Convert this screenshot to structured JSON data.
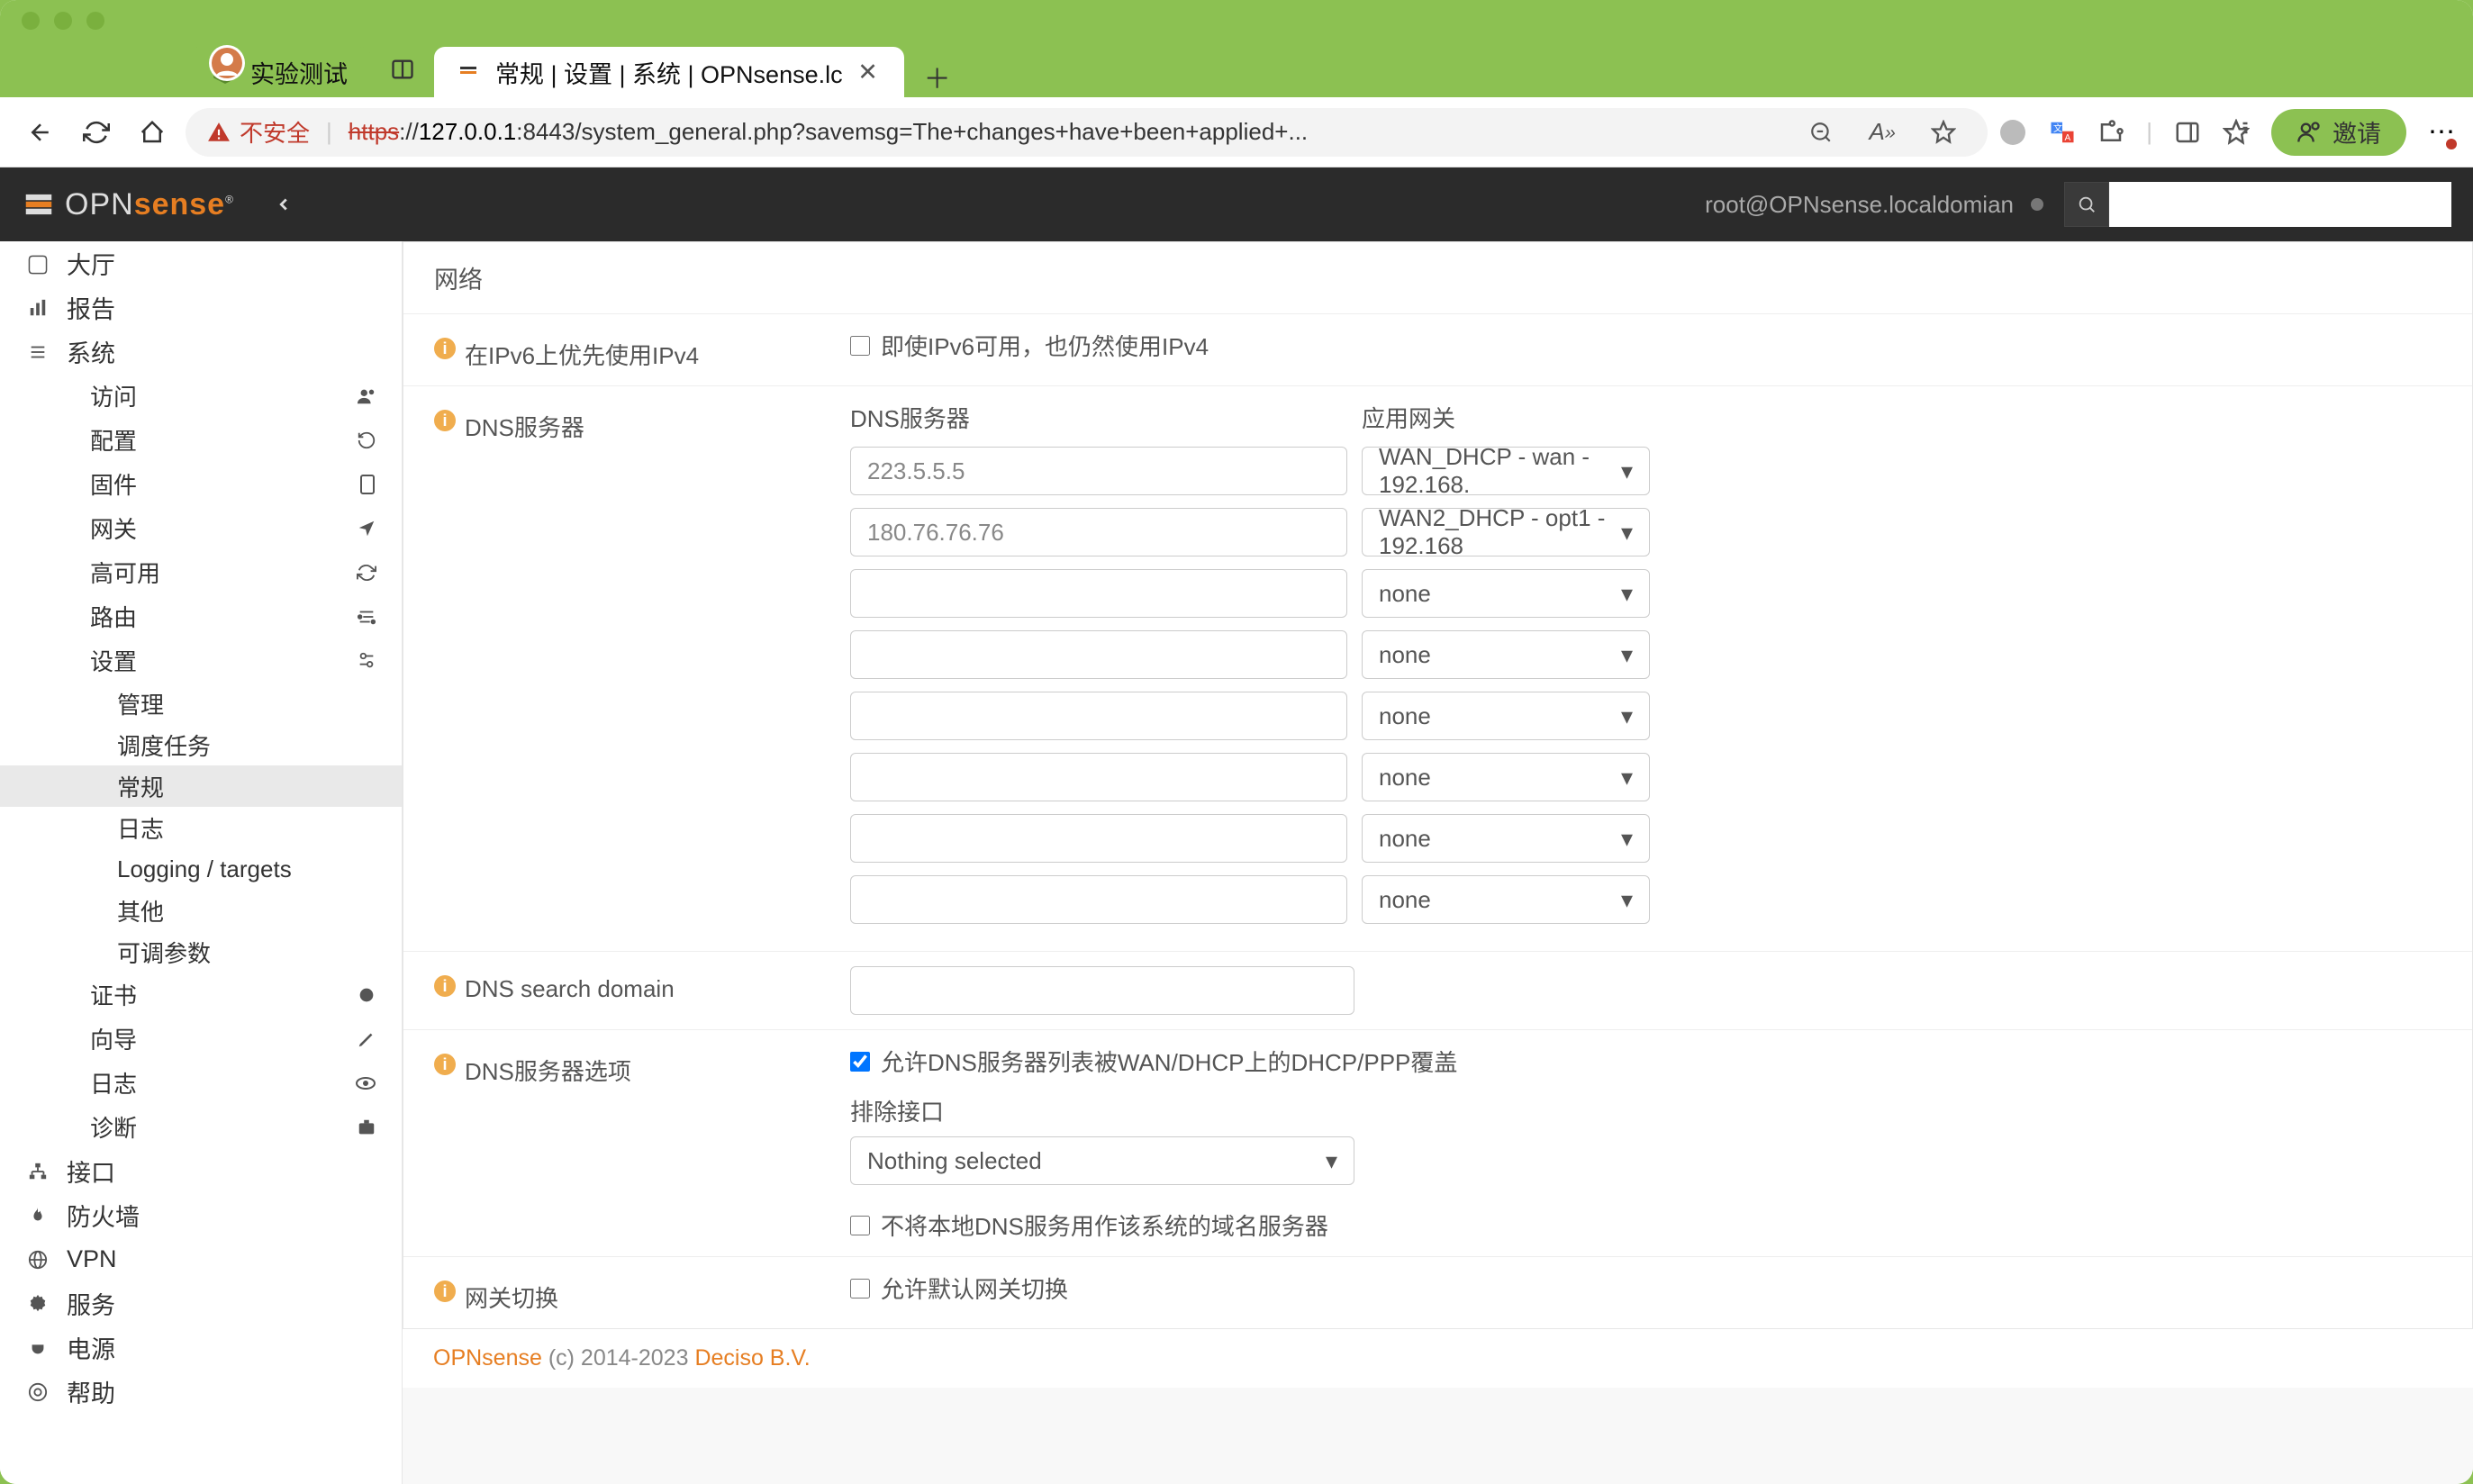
{
  "browser": {
    "tabs": [
      {
        "label": "实验测试",
        "active": false
      },
      {
        "label": "常规 | 设置 | 系统 | OPNsense.lc",
        "active": true
      }
    ],
    "security_label": "不安全",
    "url_strike": "https",
    "url_pre": "://",
    "url_bold": "127.0.0.1",
    "url_rest": ":8443/system_general.php?savemsg=The+changes+have+been+applied+...",
    "invite_label": "邀请"
  },
  "topbar": {
    "logo_prefix": "OPN",
    "logo_suffix": "sense",
    "user": "root@OPNsense.localdomian"
  },
  "nav": {
    "lobby": "大厅",
    "report": "报告",
    "system": "系统",
    "access": "访问",
    "config": "配置",
    "firmware": "固件",
    "gateway": "网关",
    "ha": "高可用",
    "route": "路由",
    "settings": "设置",
    "admin": "管理",
    "cron": "调度任务",
    "general": "常规",
    "log": "日志",
    "logging_targets": "Logging / targets",
    "misc": "其他",
    "tunable": "可调参数",
    "cert": "证书",
    "wizard": "向导",
    "syslog": "日志",
    "diag": "诊断",
    "interfaces": "接口",
    "firewall": "防火墙",
    "vpn": "VPN",
    "services": "服务",
    "power": "电源",
    "help": "帮助"
  },
  "panel": {
    "title": "网络",
    "prefer_ipv4_label": "在IPv6上优先使用IPv4",
    "prefer_ipv4_check": "即使IPv6可用，也仍然使用IPv4",
    "dns_servers_label": "DNS服务器",
    "dns_header": "DNS服务器",
    "gw_header": "应用网关",
    "dns_rows": [
      {
        "ip": "223.5.5.5",
        "gw": "WAN_DHCP - wan - 192.168."
      },
      {
        "ip": "180.76.76.76",
        "gw": "WAN2_DHCP - opt1 - 192.168"
      },
      {
        "ip": "",
        "gw": "none"
      },
      {
        "ip": "",
        "gw": "none"
      },
      {
        "ip": "",
        "gw": "none"
      },
      {
        "ip": "",
        "gw": "none"
      },
      {
        "ip": "",
        "gw": "none"
      },
      {
        "ip": "",
        "gw": "none"
      }
    ],
    "dns_search_label": "DNS search domain",
    "dns_options_label": "DNS服务器选项",
    "dns_override_check": "允许DNS服务器列表被WAN/DHCP上的DHCP/PPP覆盖",
    "exclude_if_label": "排除接口",
    "nothing_selected": "Nothing selected",
    "no_local_dns_check": "不将本地DNS服务用作该系统的域名服务器",
    "gw_switch_label": "网关切换",
    "gw_switch_check": "允许默认网关切换"
  },
  "footer": {
    "brand": "OPNsense",
    "mid": " (c) 2014-2023 ",
    "company": "Deciso B.V."
  }
}
